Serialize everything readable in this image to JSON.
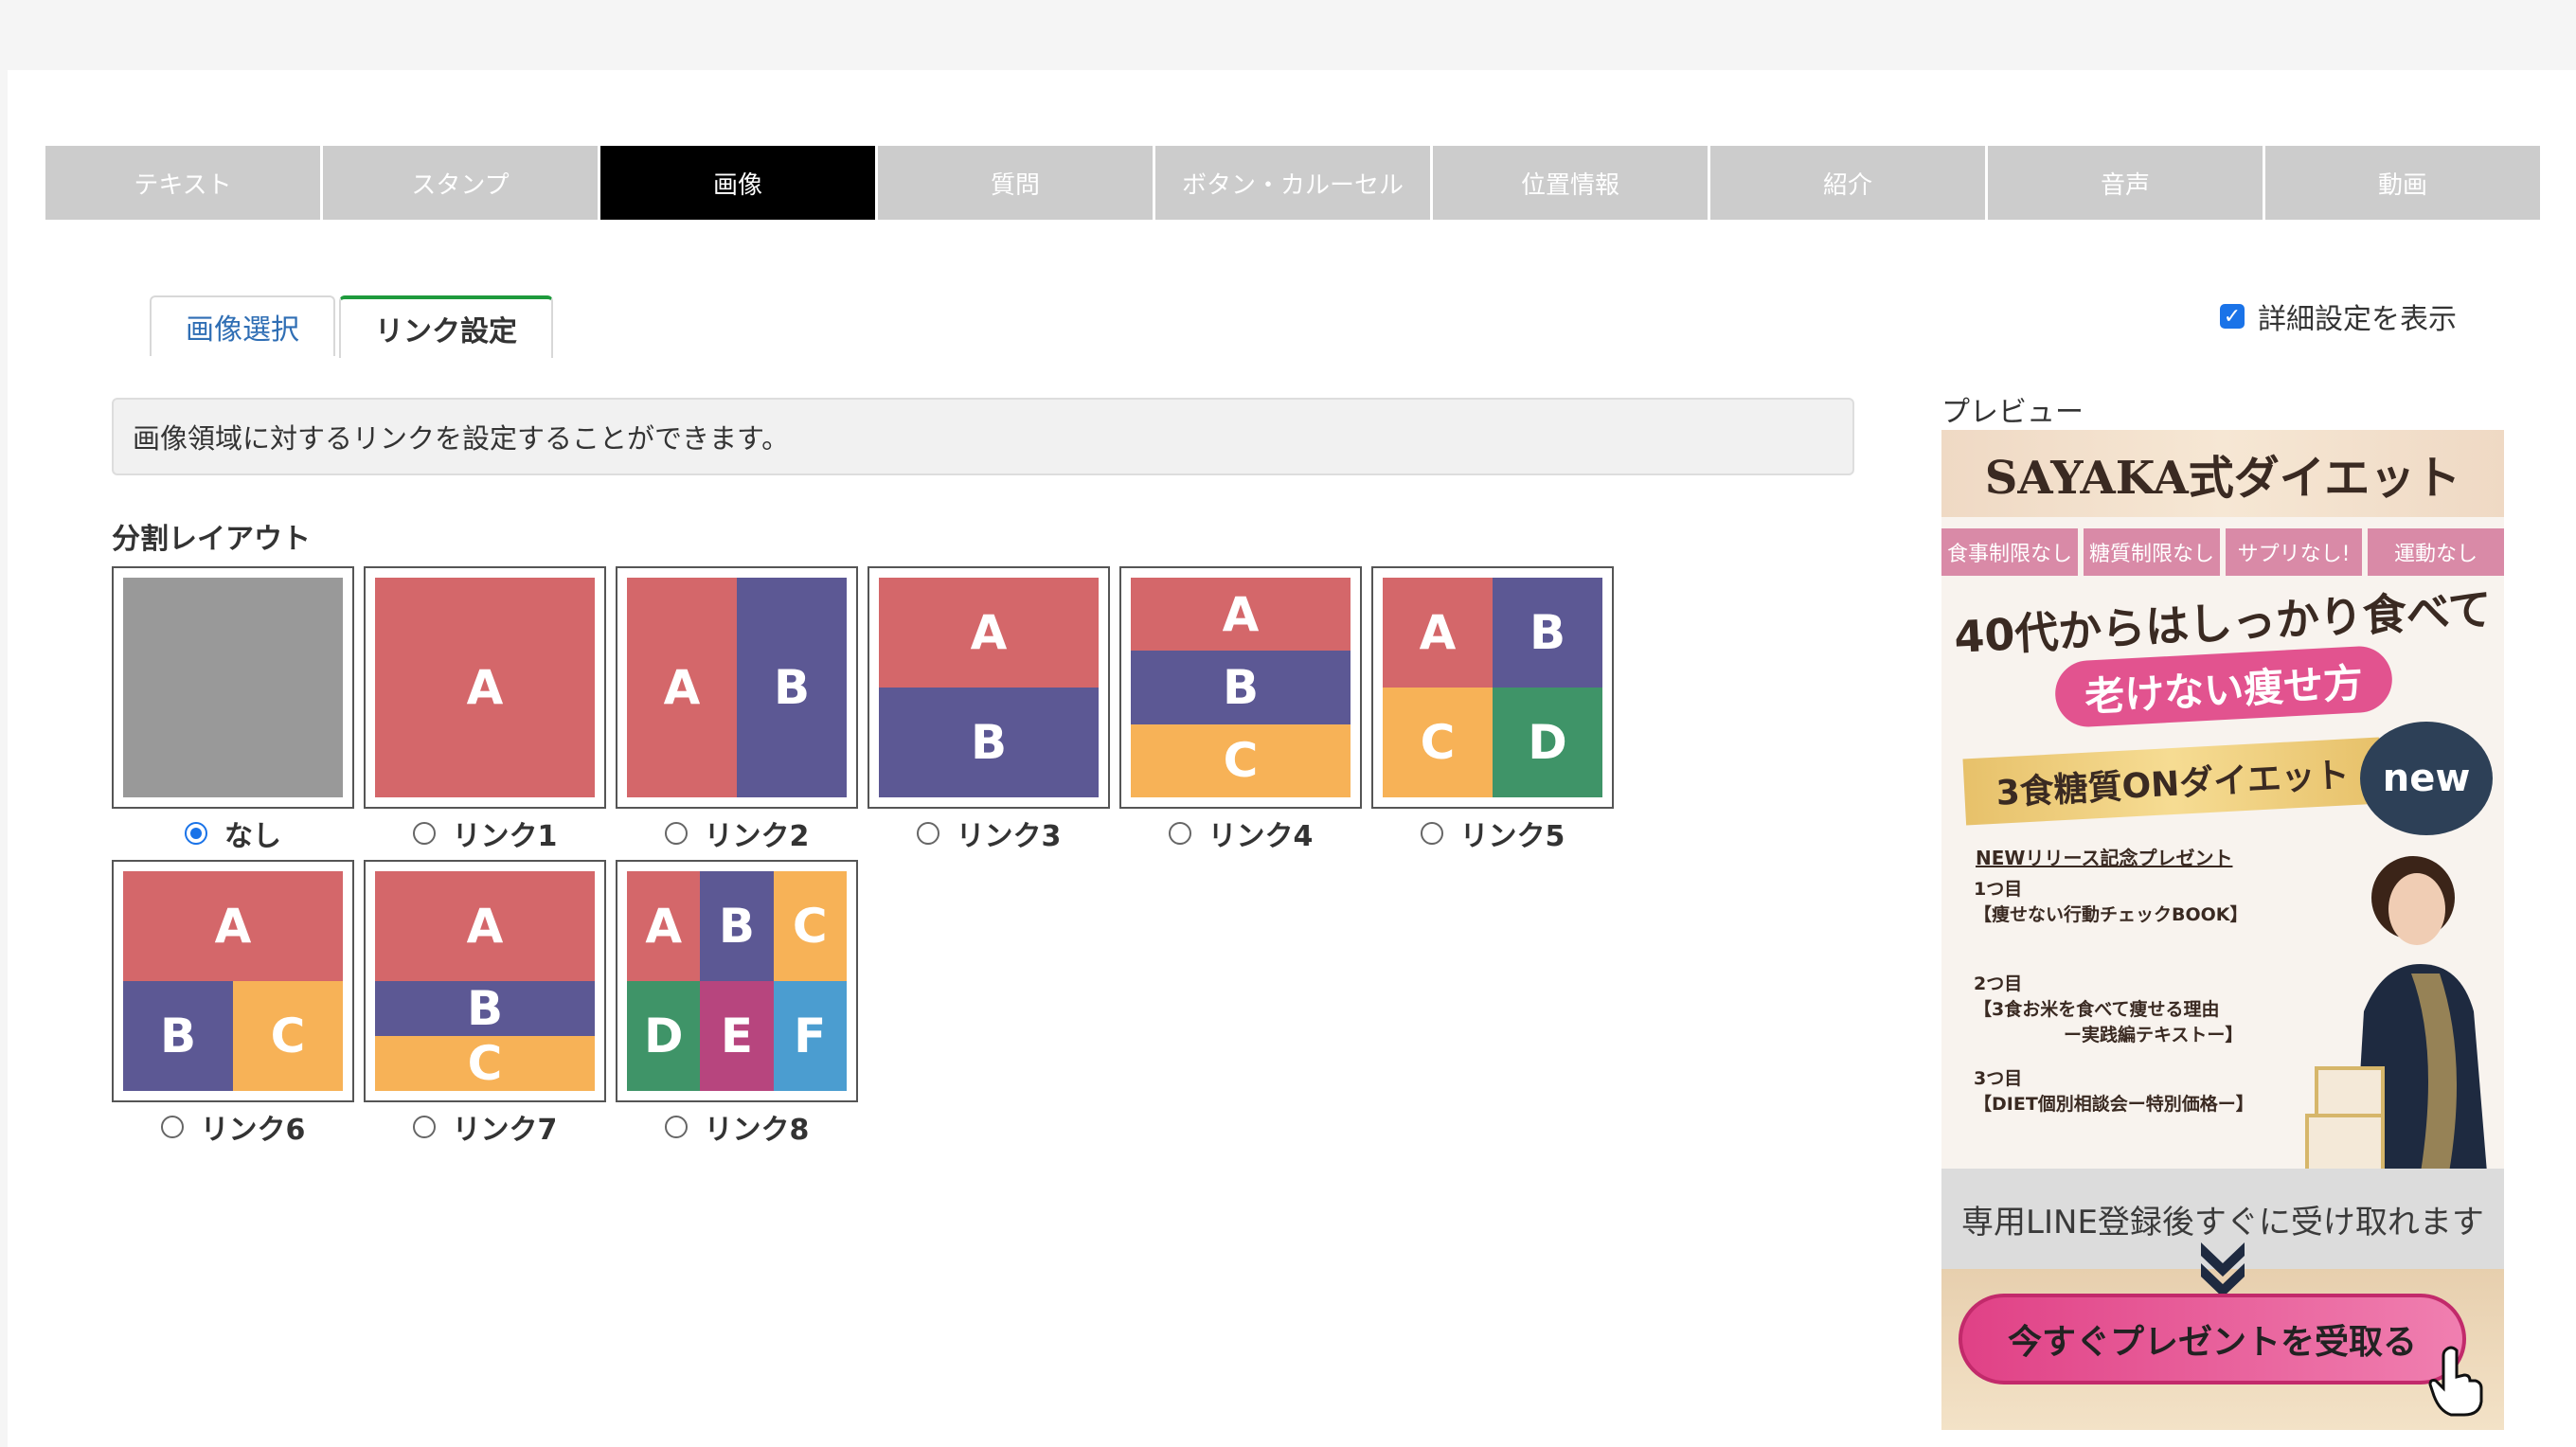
{
  "type_tabs": [
    "テキスト",
    "スタンプ",
    "画像",
    "質問",
    "ボタン・カルーセル",
    "位置情報",
    "紹介",
    "音声",
    "動画"
  ],
  "active_type_tab": "画像",
  "sub_tabs": {
    "image_select": "画像選択",
    "link_settings": "リンク設定"
  },
  "detail_toggle": {
    "label": "詳細設定を表示",
    "checked": true
  },
  "info_text": "画像領域に対するリンクを設定することができます。",
  "layout_section_label": "分割レイアウト",
  "layouts": [
    {
      "label": "なし",
      "cells": [],
      "selected": true
    },
    {
      "label": "リンク1",
      "cells": [
        "A"
      ]
    },
    {
      "label": "リンク2",
      "cells": [
        "A",
        "B"
      ]
    },
    {
      "label": "リンク3",
      "cells": [
        "A",
        "B"
      ]
    },
    {
      "label": "リンク4",
      "cells": [
        "A",
        "B",
        "C"
      ]
    },
    {
      "label": "リンク5",
      "cells": [
        "A",
        "B",
        "C",
        "D"
      ]
    },
    {
      "label": "リンク6",
      "cells": [
        "A",
        "B",
        "C"
      ]
    },
    {
      "label": "リンク7",
      "cells": [
        "A",
        "B",
        "C"
      ]
    },
    {
      "label": "リンク8",
      "cells": [
        "A",
        "B",
        "C",
        "D",
        "E",
        "F"
      ]
    }
  ],
  "preview": {
    "label": "プレビュー",
    "title": "SAYAKA式ダイエット",
    "tags": [
      "食事制限なし",
      "糖質制限なし",
      "サプリなし!",
      "運動なし"
    ],
    "headline": "40代からはしっかり食べて",
    "pill": "老けない痩せ方",
    "banner": "3食糖質ONダイエット",
    "new_badge": "new",
    "gift_heading": "NEWリリース記念プレゼント",
    "gifts": [
      "1つ目\n【痩せない行動チェックBOOK】",
      "2つ目\n【3食お米を食べて痩せる理由\n　　　　　ー実践編テキストー】",
      "3つ目\n【DIET個別相談会ー特別価格ー】"
    ],
    "receive_text": "専用LINE登録後すぐに受け取れます",
    "cta": "今すぐプレゼントを受取る"
  },
  "colors": {
    "active_tab": "#000000",
    "inactive_tab": "#cccccc",
    "cell_red": "#d4676a",
    "cell_purple": "#5c5894",
    "cell_orange": "#f7b257",
    "cell_green": "#3f9468",
    "cell_magenta": "#b7457e",
    "cell_blue": "#4b9dd0",
    "accent_green": "#1e9a3c",
    "link_blue": "#2f6eb4"
  }
}
